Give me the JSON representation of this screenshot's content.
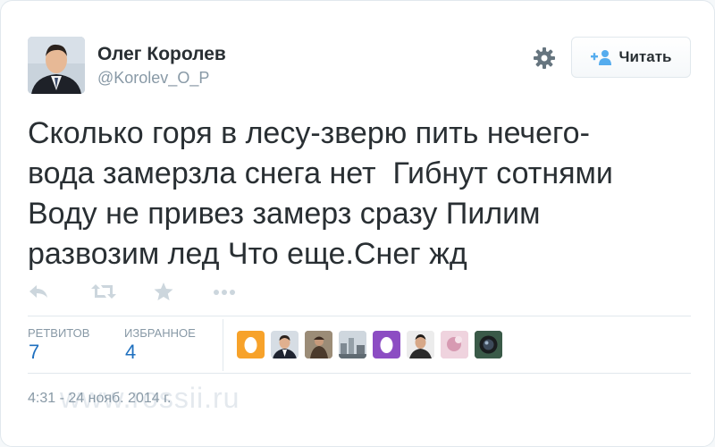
{
  "author": {
    "name": "Олег Королев",
    "handle": "@Korolev_O_P"
  },
  "follow_button": {
    "label": "Читать"
  },
  "tweet": {
    "lines": [
      "Сколько горя в лесу-зверю пить нечего-",
      "вода замерзла снега нет  Гибнут сотнями",
      "Воду не привез замерз сразу Пилим",
      "развозим лед Что еще.Снег жд"
    ]
  },
  "actions": [
    "reply-icon",
    "retweet-icon",
    "favorite-icon",
    "more-icon"
  ],
  "stats": {
    "retweets": {
      "label": "РЕТВИТОВ",
      "value": "7"
    },
    "favorites": {
      "label": "ИЗБРАННОЕ",
      "value": "4"
    }
  },
  "favoriters": [
    "egg-avatar-orange",
    "man-in-suit-avatar",
    "hunter-avatar",
    "street-avatar",
    "egg-avatar-purple",
    "man-portrait-avatar",
    "pink-avatar",
    "camera-avatar"
  ],
  "timestamp": "4:31 - 24 нояб. 2014 г.",
  "watermark": "www.rossii.ru",
  "colors": {
    "accent": "#1f70bf",
    "text": "#292f33",
    "muted": "#8899a6",
    "border": "#e1e8ed",
    "egg_orange": "#f7a22a",
    "egg_purple": "#8c4dc3"
  }
}
